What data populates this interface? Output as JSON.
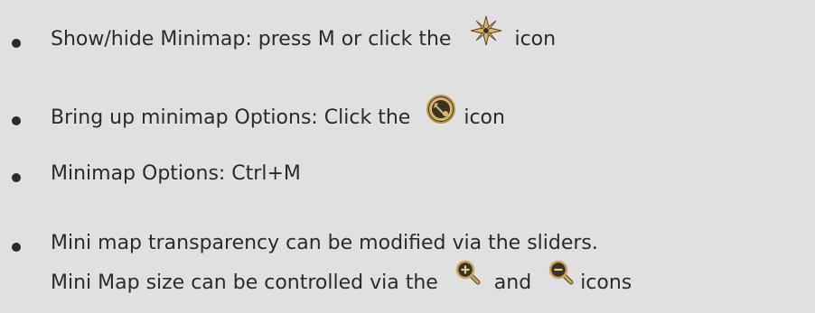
{
  "items": [
    {
      "before": "Show/hide Minimap: press M or click the",
      "icon": "compass-star-icon",
      "after": "icon"
    },
    {
      "before": "Bring up minimap Options: Click the",
      "icon": "wrench-circle-icon",
      "after": "icon"
    },
    {
      "text": "Minimap Options: Ctrl+M"
    },
    {
      "line1": "Mini map transparency can be modified via the sliders.",
      "line2_before": "Mini Map size can be controlled via the",
      "icon_a": "zoom-in-icon",
      "middle": "and",
      "icon_b": "zoom-out-icon",
      "after": "icons"
    }
  ],
  "colors": {
    "background": "#e0e0e0",
    "text": "#2b2b2b",
    "icon_gold": "#c9a45a",
    "icon_dark": "#3a3324"
  }
}
